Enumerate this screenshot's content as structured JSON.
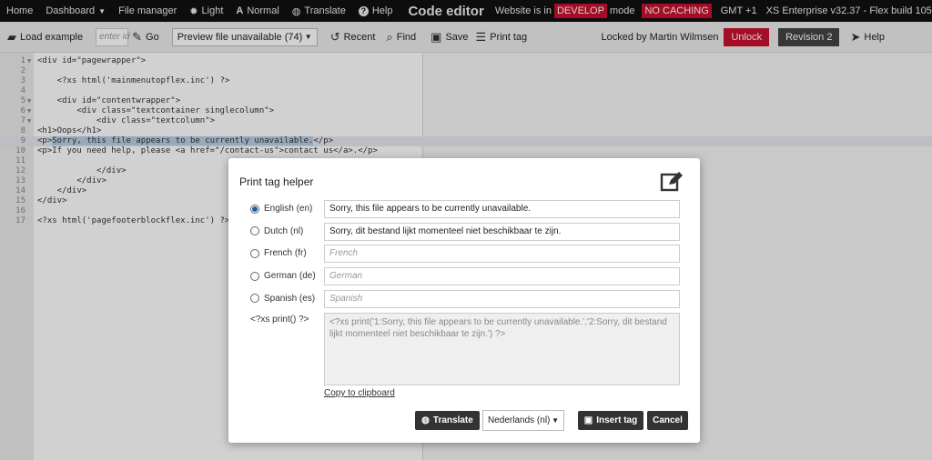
{
  "topnav": {
    "home": "Home",
    "dashboard": "Dashboard",
    "file_manager": "File manager",
    "light": "Light",
    "normal": "Normal",
    "translate": "Translate",
    "help": "Help",
    "title": "Code editor",
    "website_is_in": "Website is in",
    "develop_badge": "DEVELOP",
    "mode": "mode",
    "caching_badge": "NO CACHING",
    "timezone": "GMT +1",
    "version": "XS Enterprise v32.37 - Flex build 1051"
  },
  "toolbar": {
    "load_example": "Load example",
    "id_placeholder": "enter id",
    "go": "Go",
    "preview_select": "Preview file unavailable (74)",
    "recent": "Recent",
    "find": "Find",
    "save": "Save",
    "print_tag": "Print tag",
    "locked_by": "Locked by Martin Wilmsen",
    "unlock": "Unlock",
    "revision": "Revision 2",
    "help": "Help"
  },
  "code": {
    "lines": [
      {
        "n": "1",
        "fold": true,
        "text": "<div id=\"pagewrapper\">"
      },
      {
        "n": "2",
        "fold": false,
        "text": ""
      },
      {
        "n": "3",
        "fold": false,
        "text": "    <?xs html('mainmenutopflex.inc') ?>"
      },
      {
        "n": "4",
        "fold": false,
        "text": ""
      },
      {
        "n": "5",
        "fold": true,
        "text": "    <div id=\"contentwrapper\">"
      },
      {
        "n": "6",
        "fold": true,
        "text": "        <div class=\"textcontainer singlecolumn\">"
      },
      {
        "n": "7",
        "fold": true,
        "text": "            <div class=\"textcolumn\">"
      },
      {
        "n": "8",
        "fold": false,
        "text": "<h1>Oops</h1>"
      },
      {
        "n": "9",
        "fold": false,
        "text": ""
      },
      {
        "n": "10",
        "fold": false,
        "text": "<p>If you need help, please <a href=\"/contact-us\">contact us</a>.</p>"
      },
      {
        "n": "11",
        "fold": false,
        "text": ""
      },
      {
        "n": "12",
        "fold": false,
        "text": "            </div>"
      },
      {
        "n": "13",
        "fold": false,
        "text": "        </div>"
      },
      {
        "n": "14",
        "fold": false,
        "text": "    </div>"
      },
      {
        "n": "15",
        "fold": false,
        "text": "</div>"
      },
      {
        "n": "16",
        "fold": false,
        "text": ""
      },
      {
        "n": "17",
        "fold": false,
        "text": "<?xs html('pagefooterblockflex.inc') ?>"
      }
    ],
    "line9_open": "<p>",
    "line9_selected": "Sorry, this file appears to be currently unavailable.",
    "line9_close": "</p>"
  },
  "dialog": {
    "title": "Print tag helper",
    "languages": [
      {
        "label": "English (en)",
        "value": "Sorry, this file appears to be currently unavailable.",
        "placeholder": "",
        "checked": true
      },
      {
        "label": "Dutch (nl)",
        "value": "Sorry, dit bestand lijkt momenteel niet beschikbaar te zijn.",
        "placeholder": "",
        "checked": false
      },
      {
        "label": "French (fr)",
        "value": "",
        "placeholder": "French",
        "checked": false
      },
      {
        "label": "German (de)",
        "value": "",
        "placeholder": "German",
        "checked": false
      },
      {
        "label": "Spanish (es)",
        "value": "",
        "placeholder": "Spanish",
        "checked": false
      }
    ],
    "print_label": "<?xs print() ?>",
    "print_output": "<?xs print('1:Sorry, this file appears to be currently unavailable.','2:Sorry, dit bestand lijkt momenteel niet beschikbaar te zijn.') ?>",
    "copy": "Copy to clipboard",
    "translate": "Translate",
    "target_language": "Nederlands (nl)",
    "insert": "Insert tag",
    "cancel": "Cancel"
  },
  "icons": {
    "light": "sun-icon",
    "normal": "font-icon",
    "translate": "globe-icon",
    "help": "question-circle-icon",
    "load": "folder-open-icon",
    "go": "pencil-icon",
    "recent": "history-icon",
    "find": "search-icon",
    "save": "floppy-disk-icon",
    "print_tag": "list-icon",
    "helper": "cursor-icon",
    "edit": "edit-icon"
  },
  "colors": {
    "accent_red": "#c8102e",
    "nav_bg": "#111111",
    "toolbar_bg": "#ececec",
    "button_dark": "#333333"
  }
}
